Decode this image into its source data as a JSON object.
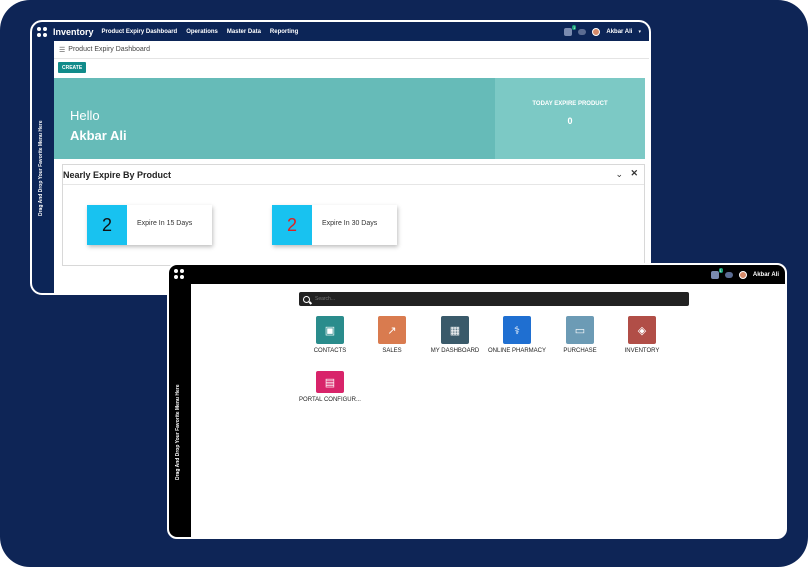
{
  "win1": {
    "app_name": "Inventory",
    "menu": [
      "Product Expiry Dashboard",
      "Operations",
      "Master Data",
      "Reporting"
    ],
    "notif_count": "1",
    "user": "Akbar Ali",
    "side_text": "Drag And Drop Your Favorite Menu Here",
    "breadcrumb": "Product Expiry Dashboard",
    "create_label": "CREATE",
    "hello": "Hello",
    "hello_name": "Akbar Ali",
    "today_label": "TODAY EXPIRE PRODUCT",
    "today_value": "0",
    "panel_title": "Nearly Expire By Product",
    "cards": [
      {
        "value": "2",
        "label": "Expire In 15 Days"
      },
      {
        "value": "2",
        "label": "Expire In 30 Days"
      }
    ]
  },
  "win2": {
    "notif_count": "1",
    "user": "Akbar Ali",
    "side_text": "Drag And Drop Your Favorite Menu Here",
    "search_placeholder": "Search...",
    "apps": [
      {
        "label": "CONTACTS",
        "icon": "contacts-icon",
        "color": "#2a8c8c"
      },
      {
        "label": "SALES",
        "icon": "sales-chart-icon",
        "color": "#d97b4f"
      },
      {
        "label": "MY DASHBOARD",
        "icon": "dashboard-icon",
        "color": "#3a5a6a"
      },
      {
        "label": "ONLINE PHARMACY",
        "icon": "pharmacy-icon",
        "color": "#1f6fd1"
      },
      {
        "label": "PURCHASE",
        "icon": "purchase-card-icon",
        "color": "#6c9bb5"
      },
      {
        "label": "INVENTORY",
        "icon": "inventory-box-icon",
        "color": "#b14e47"
      },
      {
        "label": "PORTAL CONFIGUR...",
        "icon": "portal-config-icon",
        "color": "#d8246a"
      }
    ]
  }
}
